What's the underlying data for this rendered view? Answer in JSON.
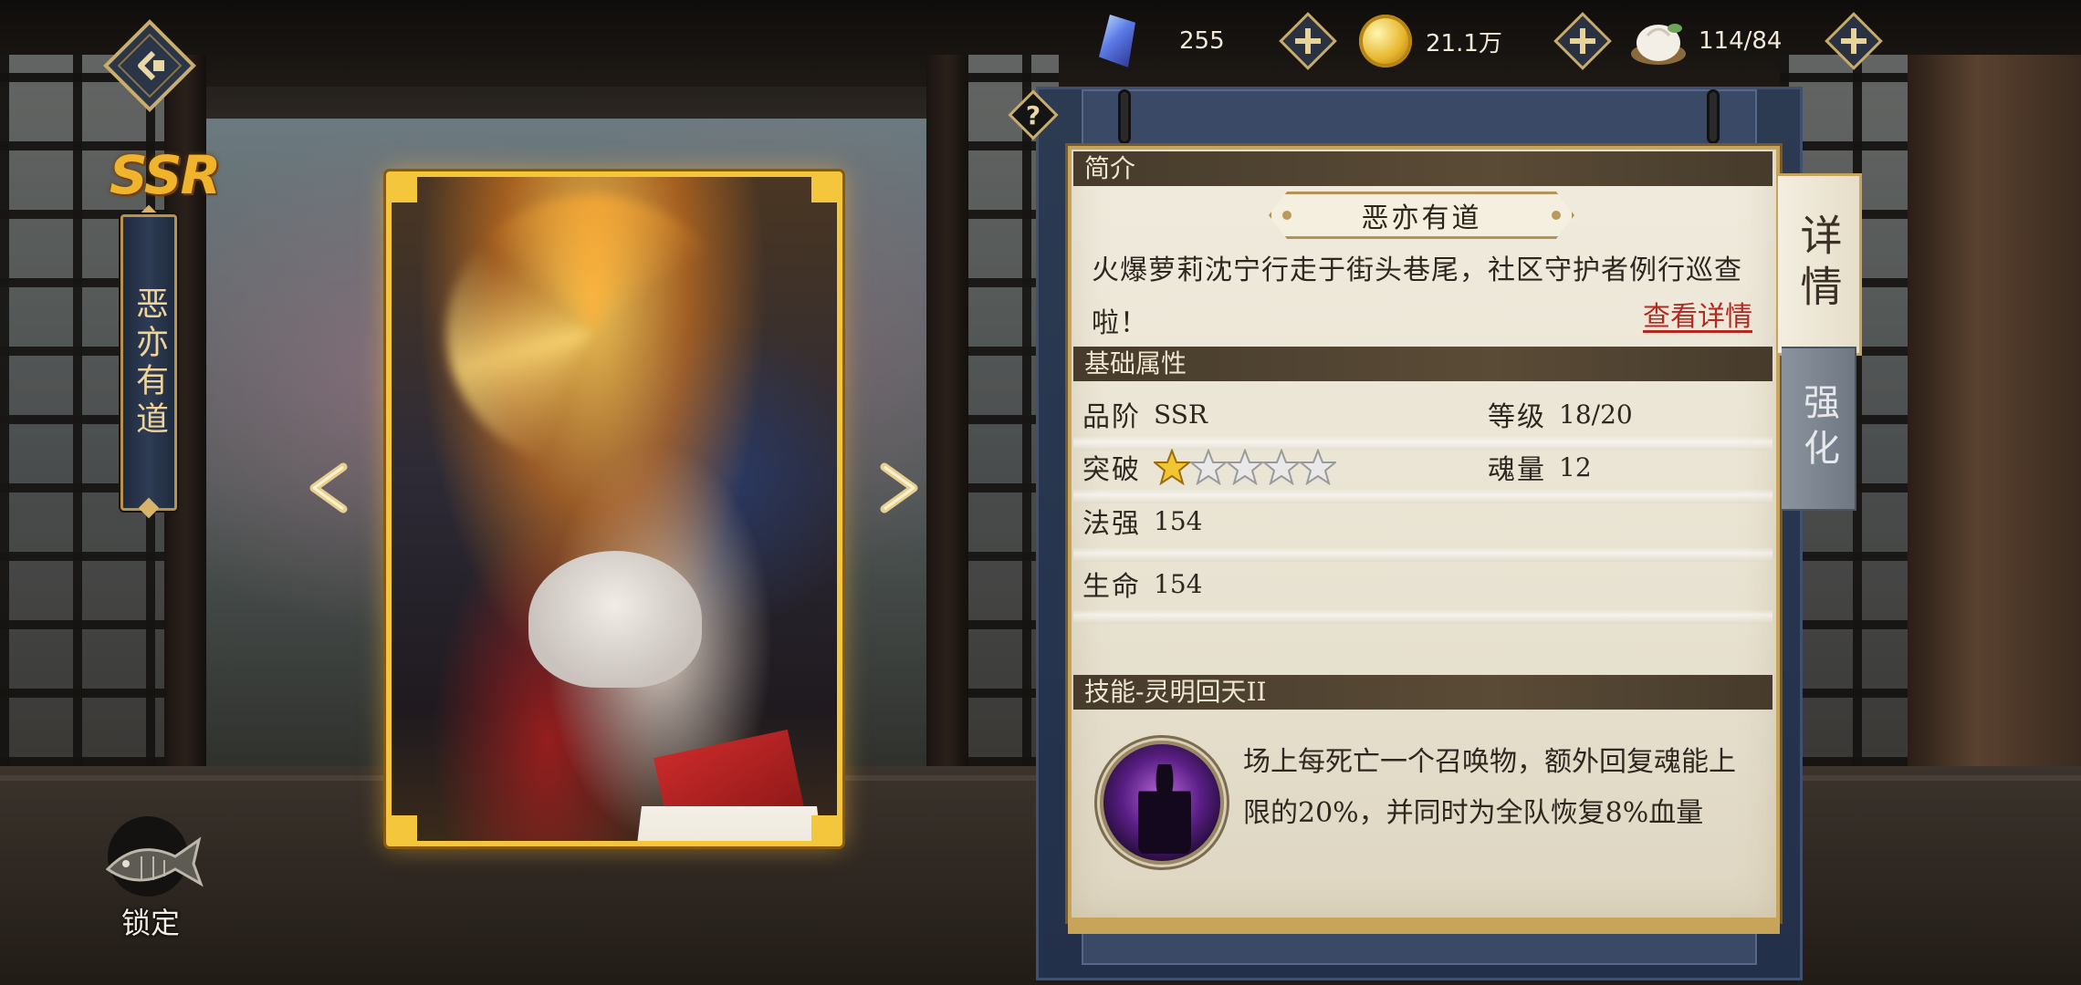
{
  "resources": {
    "gem": {
      "icon": "gem-icon",
      "value": "255"
    },
    "coin": {
      "icon": "coin-icon",
      "value": "21.1万"
    },
    "stamina": {
      "icon": "bun-icon",
      "value": "114/84"
    }
  },
  "character": {
    "rarity": "SSR",
    "name": "恶亦有道"
  },
  "lock": {
    "label": "锁定",
    "icon": "fish-lock-icon"
  },
  "panel": {
    "intro_header": "简介",
    "title": "恶亦有道",
    "description": "火爆萝莉沈宁行走于街头巷尾，社区守护者例行巡查啦！",
    "detail_link": "查看详情",
    "attributes_header": "基础属性",
    "attributes": {
      "grade": {
        "label": "品阶",
        "value": "SSR"
      },
      "level": {
        "label": "等级",
        "value": "18/20"
      },
      "breakthrough": {
        "label": "突破",
        "stars_filled": 1,
        "stars_total": 5
      },
      "soul": {
        "label": "魂量",
        "value": "12"
      },
      "magic": {
        "label": "法强",
        "value": "154"
      },
      "hp": {
        "label": "生命",
        "value": "154"
      }
    },
    "skill_header": "技能-灵明回天II",
    "skill_description": "场上每死亡一个召唤物，额外回复魂能上限的20%，并同时为全队恢复8%血量"
  },
  "tabs": {
    "details": "详情",
    "enhance": "强化"
  },
  "colors": {
    "gold": "#f3c63b",
    "panel_navy": "#2c3a52",
    "paper": "#f0ebdd",
    "link_red": "#b32a22",
    "section_brown": "#463b2c"
  }
}
